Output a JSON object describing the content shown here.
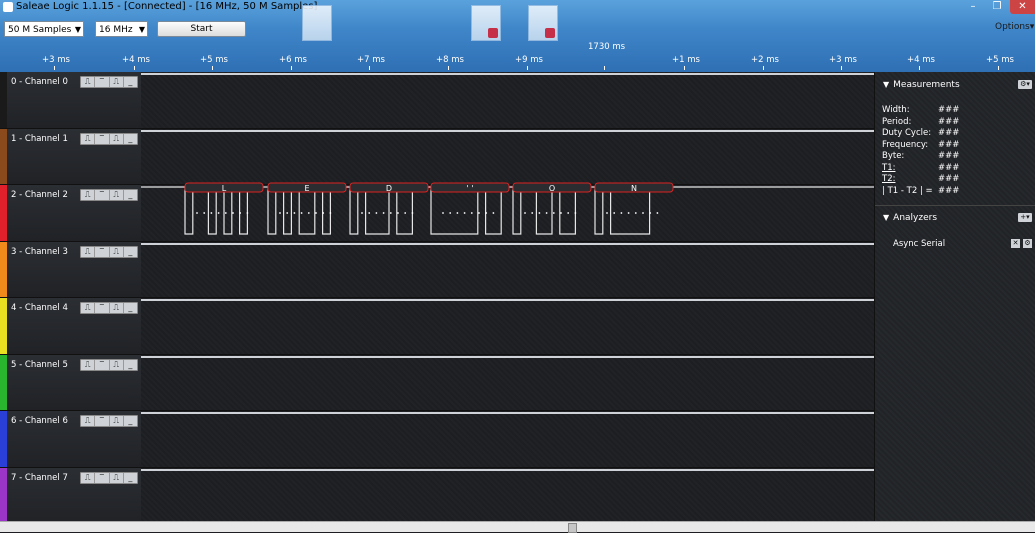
{
  "window": {
    "title": "Saleae Logic 1.1.15 - [Connected] - [16 MHz, 50 M Samples]",
    "minimize": "–",
    "maximize": "❐",
    "close": "✕"
  },
  "toolbar": {
    "samples_value": "50 M Samples",
    "rate_value": "16 MHz",
    "start_label": "Start",
    "options_label": "Options▾"
  },
  "timeline": {
    "center_time": "1730 ms",
    "ticks": [
      "+3 ms",
      "+4 ms",
      "+5 ms",
      "+6 ms",
      "+7 ms",
      "+8 ms",
      "+9 ms",
      "+1 ms",
      "+2 ms",
      "+3 ms",
      "+4 ms",
      "+5 ms"
    ]
  },
  "channels": [
    {
      "label": "0 - Channel 0",
      "color": "#1a1a1a"
    },
    {
      "label": "1 - Channel 1",
      "color": "#8a4a1c"
    },
    {
      "label": "2 - Channel 2",
      "color": "#e0202a"
    },
    {
      "label": "3 - Channel 3",
      "color": "#f08a1a"
    },
    {
      "label": "4 - Channel 4",
      "color": "#e8e020"
    },
    {
      "label": "5 - Channel 5",
      "color": "#29b62e"
    },
    {
      "label": "6 - Channel 6",
      "color": "#2a3fd8"
    },
    {
      "label": "7 - Channel 7",
      "color": "#9b35c7"
    }
  ],
  "trigger_buttons": [
    "⎍",
    "‾",
    "⎍",
    "_"
  ],
  "decoded": [
    {
      "char": "L"
    },
    {
      "char": "E"
    },
    {
      "char": "D"
    },
    {
      "char": "' '"
    },
    {
      "char": "O"
    },
    {
      "char": "N"
    }
  ],
  "sidebar": {
    "measurements_title": "Measurements",
    "measurements": [
      {
        "label": "Width:",
        "value": "###"
      },
      {
        "label": "Period:",
        "value": "###"
      },
      {
        "label": "Duty Cycle:",
        "value": "###"
      },
      {
        "label": "Frequency:",
        "value": "###"
      },
      {
        "label": "Byte:",
        "value": "###"
      },
      {
        "label": "T1:",
        "value": "###"
      },
      {
        "label": "T2:",
        "value": "###"
      },
      {
        "label": "| T1 - T2 | =",
        "value": "###"
      }
    ],
    "analyzers_title": "Analyzers",
    "analyzer_name": "Async Serial"
  }
}
